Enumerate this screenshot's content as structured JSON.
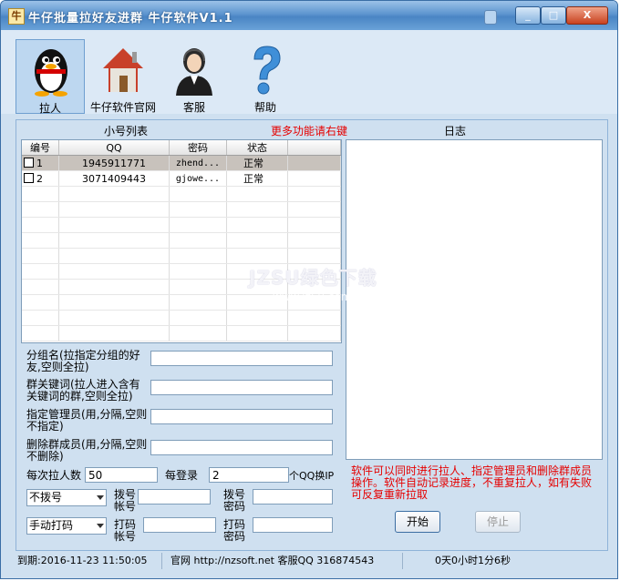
{
  "window": {
    "title": "牛仔批量拉好友进群 牛仔软件V1.1",
    "app_icon_char": "牛",
    "minimize": "_",
    "maximize": "□",
    "close": "X"
  },
  "toolbar": {
    "items": [
      {
        "label": "拉人",
        "icon": "qq-penguin-icon",
        "active": true
      },
      {
        "label": "牛仔软件官网",
        "icon": "house-icon",
        "active": false
      },
      {
        "label": "客服",
        "icon": "support-agent-icon",
        "active": false
      },
      {
        "label": "帮助",
        "icon": "help-question-icon",
        "active": false
      }
    ]
  },
  "accounts": {
    "header": "小号列表",
    "more_hint": "更多功能请右键",
    "columns": [
      "编号",
      "QQ",
      "密码",
      "状态"
    ],
    "rows": [
      {
        "id": "1",
        "qq": "1945911771",
        "password": "zhend...",
        "status": "正常"
      },
      {
        "id": "2",
        "qq": "3071409443",
        "password": "gjowe...",
        "status": "正常"
      }
    ]
  },
  "log": {
    "header": "日志"
  },
  "form": {
    "group_label": "分组名(拉指定分组的好友,空则全拉)",
    "keyword_label": "群关键词(拉人进入含有关键词的群,空则全拉)",
    "admin_label": "指定管理员(用,分隔,空则不指定)",
    "remove_label": "删除群成员(用,分隔,空则不删除)",
    "per_pull_label": "每次拉人数",
    "per_pull_value": "50",
    "per_login_label": "每登录",
    "per_login_value": "2",
    "ip_suffix": "个QQ换IP",
    "dial_select": "不拨号",
    "dial_account_label": "拨号帐号",
    "dial_password_label": "拨号密码",
    "captcha_select": "手动打码",
    "captcha_account_label": "打码帐号",
    "captcha_password_label": "打码密码"
  },
  "info_text": "软件可以同时进行拉人、指定管理员和删除群成员操作。软件自动记录进度，不重复拉人，如有失败可反复重新拉取",
  "buttons": {
    "start": "开始",
    "stop": "停止"
  },
  "status": {
    "expire": "到期:2016-11-23 11:50:05",
    "site": "官网 http://nzsoft.net 客服QQ 316874543",
    "elapsed": "0天0小时1分6秒"
  },
  "watermark": {
    "main": "JZSU绿色下载",
    "sub": "www.jz5u.com"
  }
}
